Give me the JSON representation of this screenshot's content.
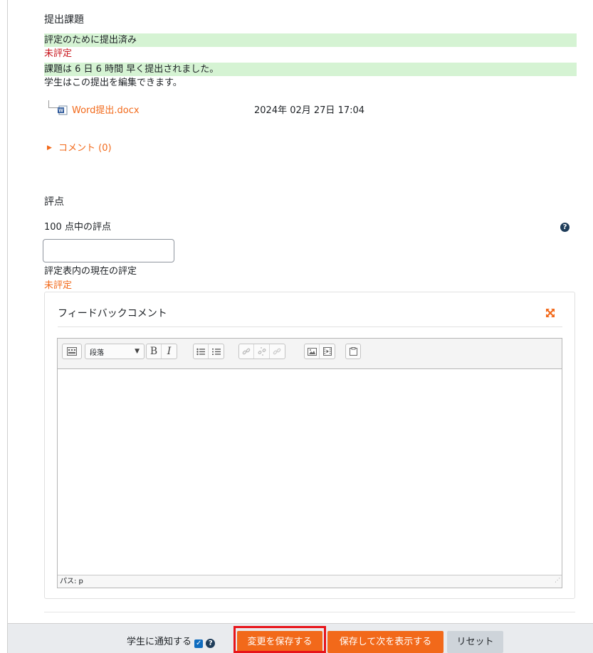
{
  "submission": {
    "heading": "提出課題",
    "status_submitted": "評定のために提出済み",
    "status_grading": "未評定",
    "time_note": "課題は 6 日 6 時間 早く提出されました。",
    "edit_note": "学生はこの提出を編集できます。",
    "file": {
      "name": "Word提出.docx",
      "date": "2024年 02月 27日 17:04",
      "icon": "word-file-icon"
    },
    "comments_label": "コメント (0)"
  },
  "grade": {
    "heading": "評点",
    "label": "100 点中の評点",
    "value": "",
    "current_label": "評定表内の現在の評定",
    "current_value": "未評定"
  },
  "feedback": {
    "heading": "フィードバックコメント",
    "toolbar": {
      "paragraph_select": "段落",
      "bold": "B",
      "italic": "I"
    },
    "path_label": "パス: p"
  },
  "footer": {
    "notify_label": "学生に通知する",
    "notify_checked": true,
    "save_button": "変更を保存する",
    "save_next_button": "保存して次を表示する",
    "reset_button": "リセット"
  },
  "colors": {
    "accent": "#f2691a",
    "success_bg": "#d5f3d3",
    "danger": "#c8161d",
    "highlight": "#e8141a"
  }
}
